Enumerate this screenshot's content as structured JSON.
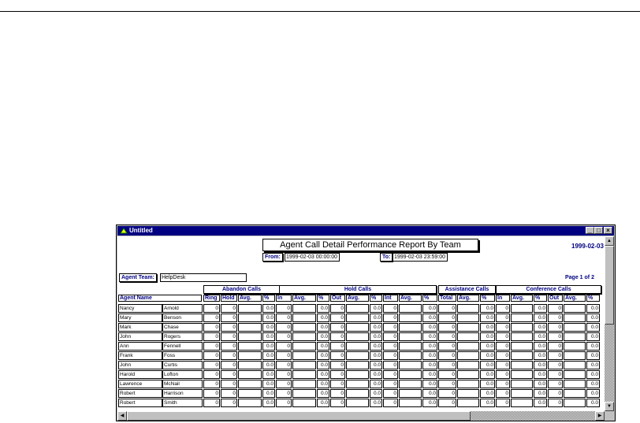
{
  "window": {
    "title": "Untitled"
  },
  "report": {
    "title": "Agent Call Detail Performance Report By Team",
    "date": "1999-02-03",
    "from_label": "From:",
    "from_value": "1999-02-03 00:00:00",
    "to_label": "To:",
    "to_value": "1999-02-03 23:59:00",
    "agent_team_label": "Agent Team:",
    "agent_team_value": "HelpDesk",
    "page": "Page 1 of 2",
    "agent_name_header": "Agent Name"
  },
  "groups": [
    "Abandon Calls",
    "Hold Calls",
    "Assistance Calls",
    "Conference Calls"
  ],
  "columns": [
    "Ring",
    "Hold",
    "Avg.",
    "%",
    "In",
    "Avg.",
    "%",
    "Out",
    "Avg.",
    "%",
    "Int",
    "Avg.",
    "%",
    "Total",
    "Avg.",
    "%",
    "In",
    "Avg.",
    "%",
    "Out",
    "Avg.",
    "%"
  ],
  "rows": [
    {
      "first": "Nancy",
      "last": "Arnold",
      "values": [
        "0",
        "0",
        "",
        "0.0",
        "0",
        "",
        "0.0",
        "0",
        "",
        "0.0",
        "0",
        "",
        "0.0",
        "0",
        "",
        "0.0",
        "0",
        "",
        "0.0",
        "0",
        "",
        "0.0"
      ]
    },
    {
      "first": "Mary",
      "last": "Benson",
      "values": [
        "0",
        "0",
        "",
        "0.0",
        "0",
        "",
        "0.0",
        "0",
        "",
        "0.0",
        "0",
        "",
        "0.0",
        "0",
        "",
        "0.0",
        "0",
        "",
        "0.0",
        "0",
        "",
        "0.0"
      ]
    },
    {
      "first": "Mark",
      "last": "Chase",
      "values": [
        "0",
        "0",
        "",
        "0.0",
        "0",
        "",
        "0.0",
        "0",
        "",
        "0.0",
        "0",
        "",
        "0.0",
        "0",
        "",
        "0.0",
        "0",
        "",
        "0.0",
        "0",
        "",
        "0.0"
      ]
    },
    {
      "first": "John",
      "last": "Rogers",
      "values": [
        "0",
        "0",
        "",
        "0.0",
        "0",
        "",
        "0.0",
        "0",
        "",
        "0.0",
        "0",
        "",
        "0.0",
        "0",
        "",
        "0.0",
        "0",
        "",
        "0.0",
        "0",
        "",
        "0.0"
      ]
    },
    {
      "first": "Ann",
      "last": "Fennell",
      "values": [
        "0",
        "0",
        "",
        "0.0",
        "0",
        "",
        "0.0",
        "0",
        "",
        "0.0",
        "0",
        "",
        "0.0",
        "0",
        "",
        "0.0",
        "0",
        "",
        "0.0",
        "0",
        "",
        "0.0"
      ]
    },
    {
      "first": "Frank",
      "last": "Foss",
      "values": [
        "0",
        "0",
        "",
        "0.0",
        "0",
        "",
        "0.0",
        "0",
        "",
        "0.0",
        "0",
        "",
        "0.0",
        "0",
        "",
        "0.0",
        "0",
        "",
        "0.0",
        "0",
        "",
        "0.0"
      ]
    },
    {
      "first": "John",
      "last": "Curtis",
      "values": [
        "0",
        "0",
        "",
        "0.0",
        "0",
        "",
        "0.0",
        "0",
        "",
        "0.0",
        "0",
        "",
        "0.0",
        "0",
        "",
        "0.0",
        "0",
        "",
        "0.0",
        "0",
        "",
        "0.0"
      ]
    },
    {
      "first": "Harold",
      "last": "Lofton",
      "values": [
        "0",
        "0",
        "",
        "0.0",
        "0",
        "",
        "0.0",
        "0",
        "",
        "0.0",
        "0",
        "",
        "0.0",
        "0",
        "",
        "0.0",
        "0",
        "",
        "0.0",
        "0",
        "",
        "0.0"
      ]
    },
    {
      "first": "Lawrence",
      "last": "McNail",
      "values": [
        "0",
        "0",
        "",
        "0.0",
        "0",
        "",
        "0.0",
        "0",
        "",
        "0.0",
        "0",
        "",
        "0.0",
        "0",
        "",
        "0.0",
        "0",
        "",
        "0.0",
        "0",
        "",
        "0.0"
      ]
    },
    {
      "first": "Robert",
      "last": "Harrison",
      "values": [
        "0",
        "0",
        "",
        "0.0",
        "0",
        "",
        "0.0",
        "0",
        "",
        "0.0",
        "0",
        "",
        "0.0",
        "0",
        "",
        "0.0",
        "0",
        "",
        "0.0",
        "0",
        "",
        "0.0"
      ]
    },
    {
      "first": "Robert",
      "last": "Smith",
      "values": [
        "0",
        "0",
        "",
        "0.0",
        "0",
        "",
        "0.0",
        "0",
        "",
        "0.0",
        "0",
        "",
        "0.0",
        "0",
        "",
        "0.0",
        "0",
        "",
        "0.0",
        "0",
        "",
        "0.0"
      ]
    }
  ]
}
